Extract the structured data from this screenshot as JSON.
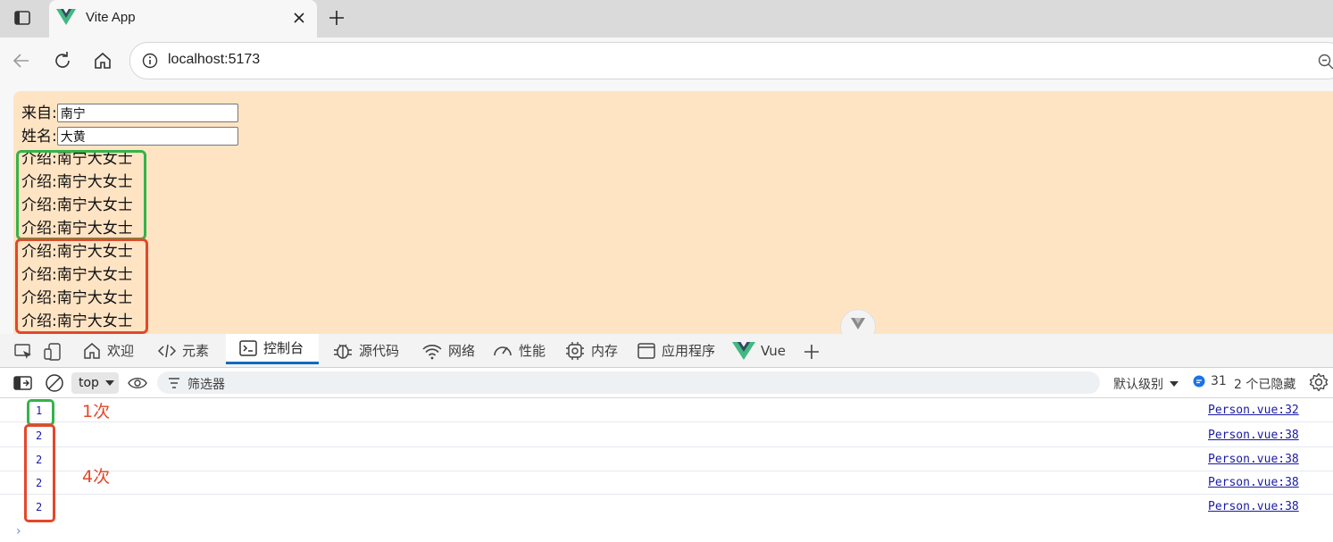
{
  "browser": {
    "tab_title": "Vite App",
    "url": "localhost:5173"
  },
  "page": {
    "from_label": "来自:",
    "from_value": "南宁",
    "name_label": "姓名:",
    "name_value": "大黄",
    "intro_lines_group1": [
      "介绍:南宁大女士",
      "介绍:南宁大女士",
      "介绍:南宁大女士",
      "介绍:南宁大女士"
    ],
    "intro_lines_group2": [
      "介绍:南宁大女士",
      "介绍:南宁大女士",
      "介绍:南宁大女士",
      "介绍:南宁大女士"
    ]
  },
  "devtools": {
    "tabs": [
      {
        "label": "欢迎",
        "icon": "home-icon"
      },
      {
        "label": "元素",
        "icon": "code-icon"
      },
      {
        "label": "控制台",
        "icon": "console-icon"
      },
      {
        "label": "源代码",
        "icon": "bug-icon"
      },
      {
        "label": "网络",
        "icon": "wifi-icon"
      },
      {
        "label": "性能",
        "icon": "gauge-icon"
      },
      {
        "label": "内存",
        "icon": "chip-icon"
      },
      {
        "label": "应用程序",
        "icon": "app-window-icon"
      },
      {
        "label": "Vue",
        "icon": "vue-logo-icon"
      }
    ],
    "active_tab": "控制台",
    "context": "top",
    "filter_placeholder": "筛选器",
    "level": "默认级别",
    "message_count": "31",
    "hidden_count": "2 个已隐藏"
  },
  "console": {
    "logs": [
      {
        "value": "1",
        "source": "Person.vue:32"
      },
      {
        "value": "2",
        "source": "Person.vue:38"
      },
      {
        "value": "2",
        "source": "Person.vue:38"
      },
      {
        "value": "2",
        "source": "Person.vue:38"
      },
      {
        "value": "2",
        "source": "Person.vue:38"
      }
    ],
    "prompt": "›"
  },
  "annotations": {
    "once": "1次",
    "four_times": "4次"
  },
  "colors": {
    "page_bg": "#ffe4c4",
    "annotation_green": "#34b34a",
    "annotation_red": "#e4472a",
    "devtools_active": "#0f6cbd"
  }
}
